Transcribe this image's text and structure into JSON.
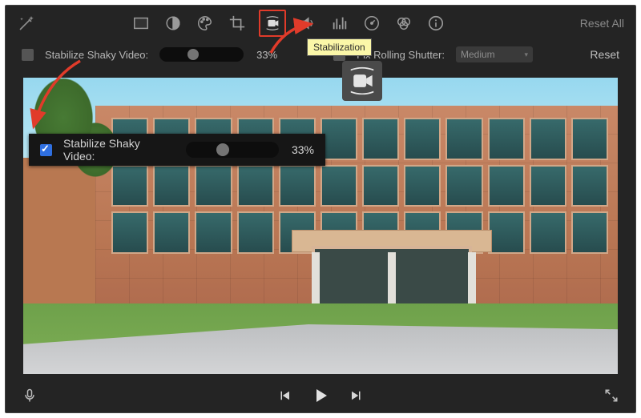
{
  "toolbar": {
    "reset_all_label": "Reset All",
    "icons": [
      "color-board-icon",
      "contrast-icon",
      "palette-icon",
      "crop-icon",
      "stabilization-icon",
      "volume-icon",
      "equalizer-icon",
      "speed-icon",
      "filters-icon",
      "info-icon"
    ]
  },
  "options": {
    "stabilize_label": "Stabilize Shaky Video:",
    "stabilize_checked": false,
    "stabilize_percent": "33%",
    "slider_value_pct": 33,
    "rolling_label": "Fix Rolling Shutter:",
    "rolling_value": "Medium",
    "reset_label": "Reset"
  },
  "float_panel": {
    "stabilize_label": "Stabilize Shaky Video:",
    "stabilize_checked": true,
    "stabilize_percent": "33%",
    "slider_value_pct": 33
  },
  "tooltip": {
    "text": "Stabilization"
  },
  "playbar": {
    "controls": [
      "prev",
      "play",
      "next"
    ]
  },
  "annotations": {
    "highlight_icon": "stabilization-icon"
  }
}
